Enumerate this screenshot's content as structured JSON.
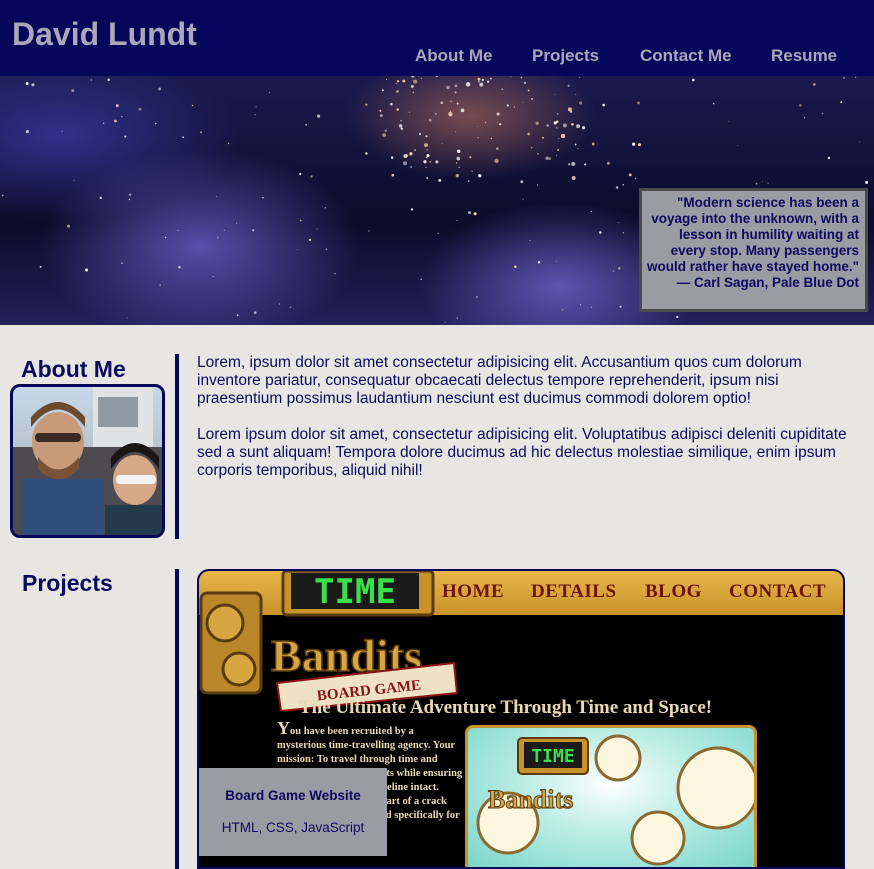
{
  "header": {
    "site_title": "David Lundt",
    "nav": [
      "About Me",
      "Projects",
      "Contact Me",
      "Resume"
    ]
  },
  "hero": {
    "quote": "\"Modern science has been a voyage into the unknown, with a lesson in humility waiting at every stop. Many passengers would rather have stayed home.\"",
    "attribution": "— Carl Sagan, Pale Blue Dot"
  },
  "about": {
    "title": "About Me",
    "paragraphs": [
      "Lorem, ipsum dolor sit amet consectetur adipisicing elit. Accusantium quos cum dolorum inventore pariatur, consequatur obcaecati delectus tempore reprehenderit, ipsum nisi praesentium possimus laudantium nesciunt est ducimus commodi dolorem optio!",
      "Lorem ipsum dolor sit amet, consectetur adipisicing elit. Voluptatibus adipisci deleniti cupiditate sed a sunt aliquam! Tempora dolore ducimus ad hic delectus molestiae similique, enim ipsum corporis temporibus, aliquid nihil!"
    ]
  },
  "projects": {
    "title": "Projects",
    "card": {
      "site_nav": [
        "HOME",
        "DETAILS",
        "BLOG",
        "CONTACT"
      ],
      "logo_word_1": "TIME",
      "logo_word_2": "Bandits",
      "logo_banner": "BOARD GAME",
      "tagline": "The Ultimate Adventure Through Time and Space!",
      "intro_dropcap": "Y",
      "intro": "ou have been recruited by a mysterious time-travelling agency. Your mission: To travel through time and locate and collect artifacts while ensuring you keep the present timeline intact. Doing it alone, you are part of a crack team of misfits assembled specifically for this dangerous",
      "caption_title": "Board Game Website",
      "caption_tech": "HTML, CSS, JavaScript"
    }
  },
  "colors": {
    "header_bg": "#06065a",
    "nav_text": "#a8a8b8",
    "page_bg": "#e8e6e2",
    "primary_text": "#0a0a5e",
    "caption_bg": "#9b9ba3",
    "card_nav_gold": "#c8922a"
  }
}
